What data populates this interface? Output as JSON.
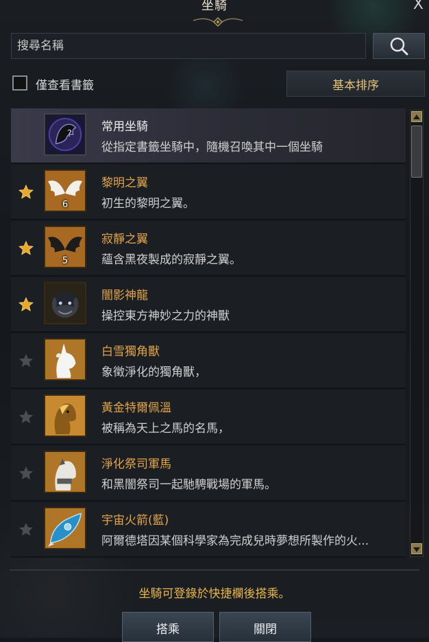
{
  "window": {
    "title": "坐騎",
    "close_label": "X"
  },
  "search": {
    "placeholder": "搜尋名稱",
    "value": ""
  },
  "filter": {
    "bookmark_only_label": "僅查看書籤",
    "checked": false
  },
  "sort": {
    "label": "基本排序"
  },
  "mounts": [
    {
      "name": "常用坐騎",
      "desc": "從指定書籤坐騎中，隨機召喚其中一個坐騎",
      "starred": null,
      "icon": "random-mount-icon",
      "count": ""
    },
    {
      "name": "黎明之翼",
      "desc": "初生的黎明之翼。",
      "starred": true,
      "icon": "white-wings-icon",
      "count": "6"
    },
    {
      "name": "寂靜之翼",
      "desc": "蘊含黑夜製成的寂靜之翼。",
      "starred": true,
      "icon": "black-wings-icon",
      "count": "5"
    },
    {
      "name": "闇影神龍",
      "desc": "操控東方神妙之力的神獸",
      "starred": true,
      "icon": "shadow-dragon-icon",
      "count": ""
    },
    {
      "name": "白雪獨角獸",
      "desc": "象徵淨化的獨角獸，",
      "starred": false,
      "icon": "white-unicorn-icon",
      "count": ""
    },
    {
      "name": "黃金特爾佩溫",
      "desc": "被稱為天上之馬的名馬，",
      "starred": false,
      "icon": "golden-horse-icon",
      "count": ""
    },
    {
      "name": "淨化祭司軍馬",
      "desc": "和黑闇祭司一起馳騁戰場的軍馬。",
      "starred": false,
      "icon": "warhorse-icon",
      "count": ""
    },
    {
      "name": "宇宙火箭(藍)",
      "desc": "阿爾德塔因某個科學家為完成兒時夢想所製作的火...",
      "starred": false,
      "icon": "blue-rocket-icon",
      "count": ""
    }
  ],
  "footer": {
    "hint": "坐騎可登錄於快捷欄後搭乘。",
    "ride_label": "搭乘",
    "close_label": "關閉"
  },
  "colors": {
    "accent": "#e2a54a",
    "star_active": "#e8a62a",
    "star_inactive": "#55585c"
  }
}
